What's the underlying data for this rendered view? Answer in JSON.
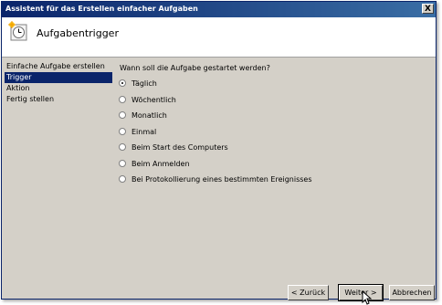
{
  "window": {
    "title": "Assistent für das Erstellen einfacher Aufgaben",
    "close_label": "X"
  },
  "header": {
    "title": "Aufgabentrigger",
    "icon": "task-clock-icon"
  },
  "sidebar": {
    "items": [
      {
        "label": "Einfache Aufgabe erstellen",
        "active": false
      },
      {
        "label": "Trigger",
        "active": true
      },
      {
        "label": "Aktion",
        "active": false
      },
      {
        "label": "Fertig stellen",
        "active": false
      }
    ]
  },
  "main": {
    "question": "Wann soll die Aufgabe gestartet werden?",
    "selected": "Täglich",
    "options": [
      {
        "label": "Täglich"
      },
      {
        "label": "Wöchentlich"
      },
      {
        "label": "Monatlich"
      },
      {
        "label": "Einmal"
      },
      {
        "label": "Beim Start des Computers"
      },
      {
        "label": "Beim Anmelden"
      },
      {
        "label": "Bei Protokollierung eines bestimmten Ereignisses"
      }
    ]
  },
  "buttons": {
    "back": "< Zurück",
    "next": "Weiter >",
    "cancel": "Abbrechen"
  },
  "colors": {
    "titlebar": "#0a246a",
    "selection": "#0a246a",
    "dialog_bg": "#d4d0c8"
  }
}
